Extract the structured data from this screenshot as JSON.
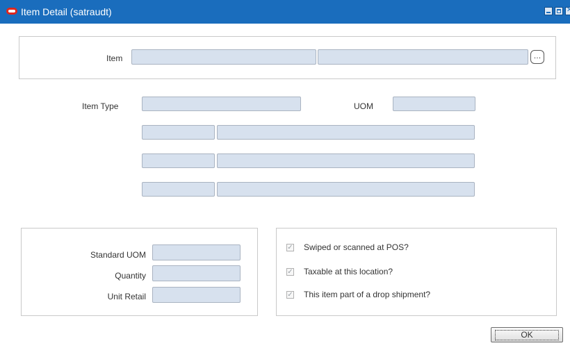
{
  "window": {
    "title": "Item Detail  (satraudt)",
    "titlebar_color": "#1a6dbd",
    "controls": [
      "minimize",
      "maximize",
      "close"
    ]
  },
  "item_group": {
    "item_label": "Item",
    "item_value": "",
    "item_desc_value": "",
    "memo_icon": "speech-bubble-icon"
  },
  "item_type_section": {
    "item_type_label": "Item Type",
    "item_type_value": "",
    "uom_label": "UOM",
    "uom_value": "",
    "rows": [
      {
        "code": "",
        "desc": ""
      },
      {
        "code": "",
        "desc": ""
      },
      {
        "code": "",
        "desc": ""
      }
    ]
  },
  "standard_group": {
    "standard_uom_label": "Standard UOM",
    "standard_uom_value": "",
    "quantity_label": "Quantity",
    "quantity_value": "",
    "unit_retail_label": "Unit Retail",
    "unit_retail_value": ""
  },
  "flags_group": {
    "swiped_label": "Swiped or scanned at POS?",
    "swiped_checked": true,
    "taxable_label": "Taxable at this location?",
    "taxable_checked": true,
    "drop_ship_label": "This item part of a drop shipment?",
    "drop_ship_checked": true
  },
  "buttons": {
    "ok_label": "OK"
  }
}
